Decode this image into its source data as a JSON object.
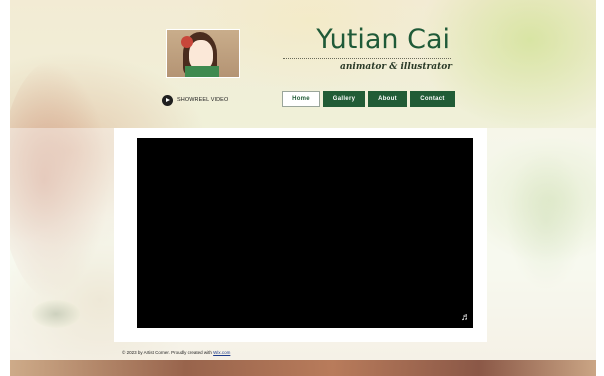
{
  "header": {
    "title": "Yutian Cai",
    "tagline": "animator & illustrator",
    "showreel_label": "SHOWREEL VIDEO",
    "avatar_icon": "avatar-illustration"
  },
  "nav": {
    "items": [
      {
        "label": "Home",
        "active": true
      },
      {
        "label": "Gallery",
        "active": false
      },
      {
        "label": "About",
        "active": false
      },
      {
        "label": "Contact",
        "active": false
      }
    ]
  },
  "video": {
    "music_icon": "music-note-icon"
  },
  "footer": {
    "text": "© 2023 by Artist Corner. Proudly created with ",
    "link_text": "Wix.com"
  },
  "colors": {
    "accent": "#215c36",
    "title": "#1f5a38",
    "video_bg": "#000000"
  }
}
